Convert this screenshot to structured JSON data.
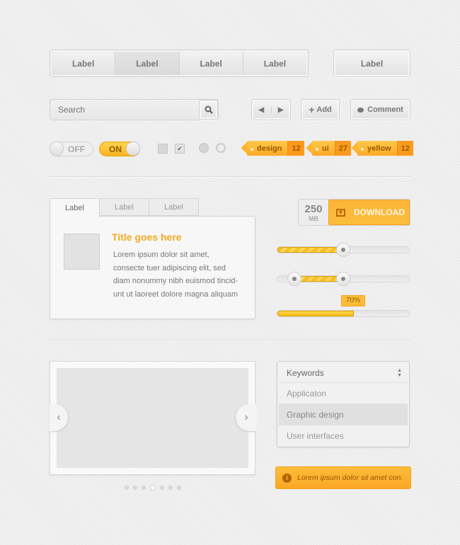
{
  "segmented": [
    "Label",
    "Label",
    "Label",
    "Label"
  ],
  "single_button": "Label",
  "search": {
    "placeholder": "Search"
  },
  "buttons": {
    "add": "Add",
    "comment": "Comment"
  },
  "toggles": {
    "off": "OFF",
    "on": "ON"
  },
  "tags": [
    {
      "label": "design",
      "count": "12"
    },
    {
      "label": "ui",
      "count": "27"
    },
    {
      "label": "yellow",
      "count": "12"
    }
  ],
  "tabs": [
    "Label",
    "Label",
    "Label"
  ],
  "panel": {
    "title": "Title goes here",
    "text": [
      "Lorem ipsum dolor sit amet,",
      "consecte tuer adipiscing elit, sed",
      "diam nonummy nibh euismod tincid-",
      "unt ut laoreet dolore magna aliquam"
    ]
  },
  "download": {
    "size": "250",
    "unit": "MB",
    "label": "DOWNLOAD"
  },
  "sliders": {
    "single_value": 50,
    "range": [
      13,
      50
    ]
  },
  "progress": {
    "value": 58,
    "label": "70%"
  },
  "carousel": {
    "dots": 7,
    "active": 4
  },
  "list": {
    "header": "Keywords",
    "items": [
      "Applicaton",
      "Graphic design",
      "User interfaces"
    ],
    "selected": "Graphic design"
  },
  "alert": {
    "text": "Lorem ipsum dolor sit amet con."
  },
  "colors": {
    "accent": "#fdb02c",
    "text": "#777777"
  }
}
